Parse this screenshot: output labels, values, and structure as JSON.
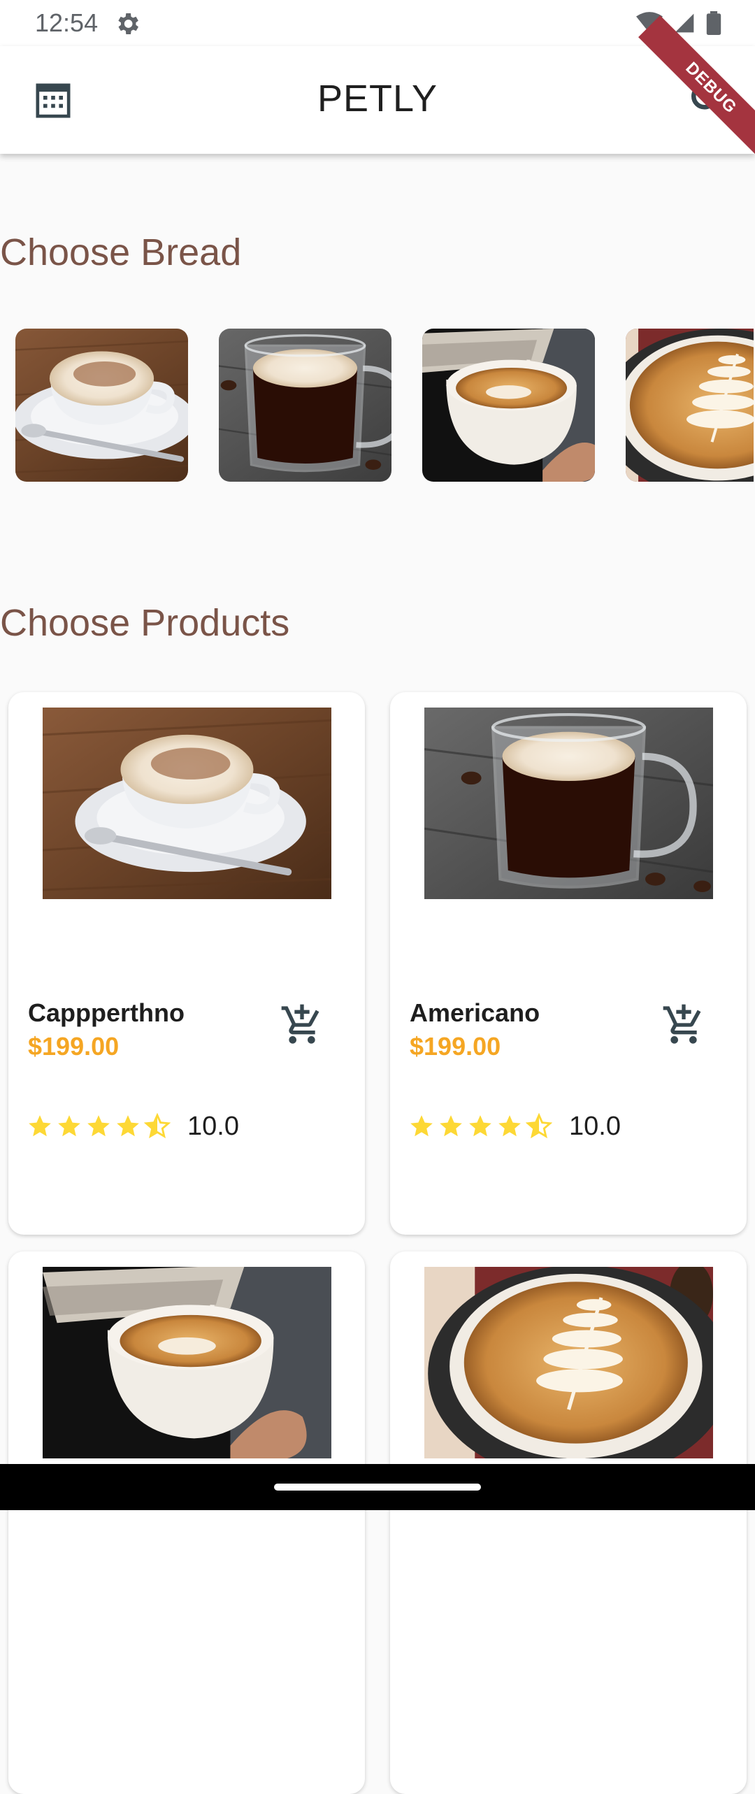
{
  "status_bar": {
    "time": "12:54"
  },
  "app_bar": {
    "title": "PETLY",
    "debug_label": "DEBUG"
  },
  "sections": {
    "bread_title": "Choose Bread",
    "products_title": "Choose Products"
  },
  "bread_items": [
    {
      "image": "cappuccino-with-cocoa"
    },
    {
      "image": "americano-glass-mug"
    },
    {
      "image": "latte-pour"
    },
    {
      "image": "latte-art"
    }
  ],
  "products": [
    {
      "name": "Cappperthno",
      "price": "$199.00",
      "rating_value": "10.0",
      "stars": 4.5,
      "image": "cappuccino-with-cocoa"
    },
    {
      "name": "Americano",
      "price": "$199.00",
      "rating_value": "10.0",
      "stars": 4.5,
      "image": "americano-glass-mug"
    },
    {
      "name": "",
      "price": "",
      "rating_value": "",
      "stars": 0,
      "image": "latte-pour"
    },
    {
      "name": "",
      "price": "",
      "rating_value": "",
      "stars": 0,
      "image": "latte-art"
    }
  ],
  "colors": {
    "accent_brown": "#7a5448",
    "price_orange": "#f5a623",
    "star_yellow": "#fdd835"
  }
}
